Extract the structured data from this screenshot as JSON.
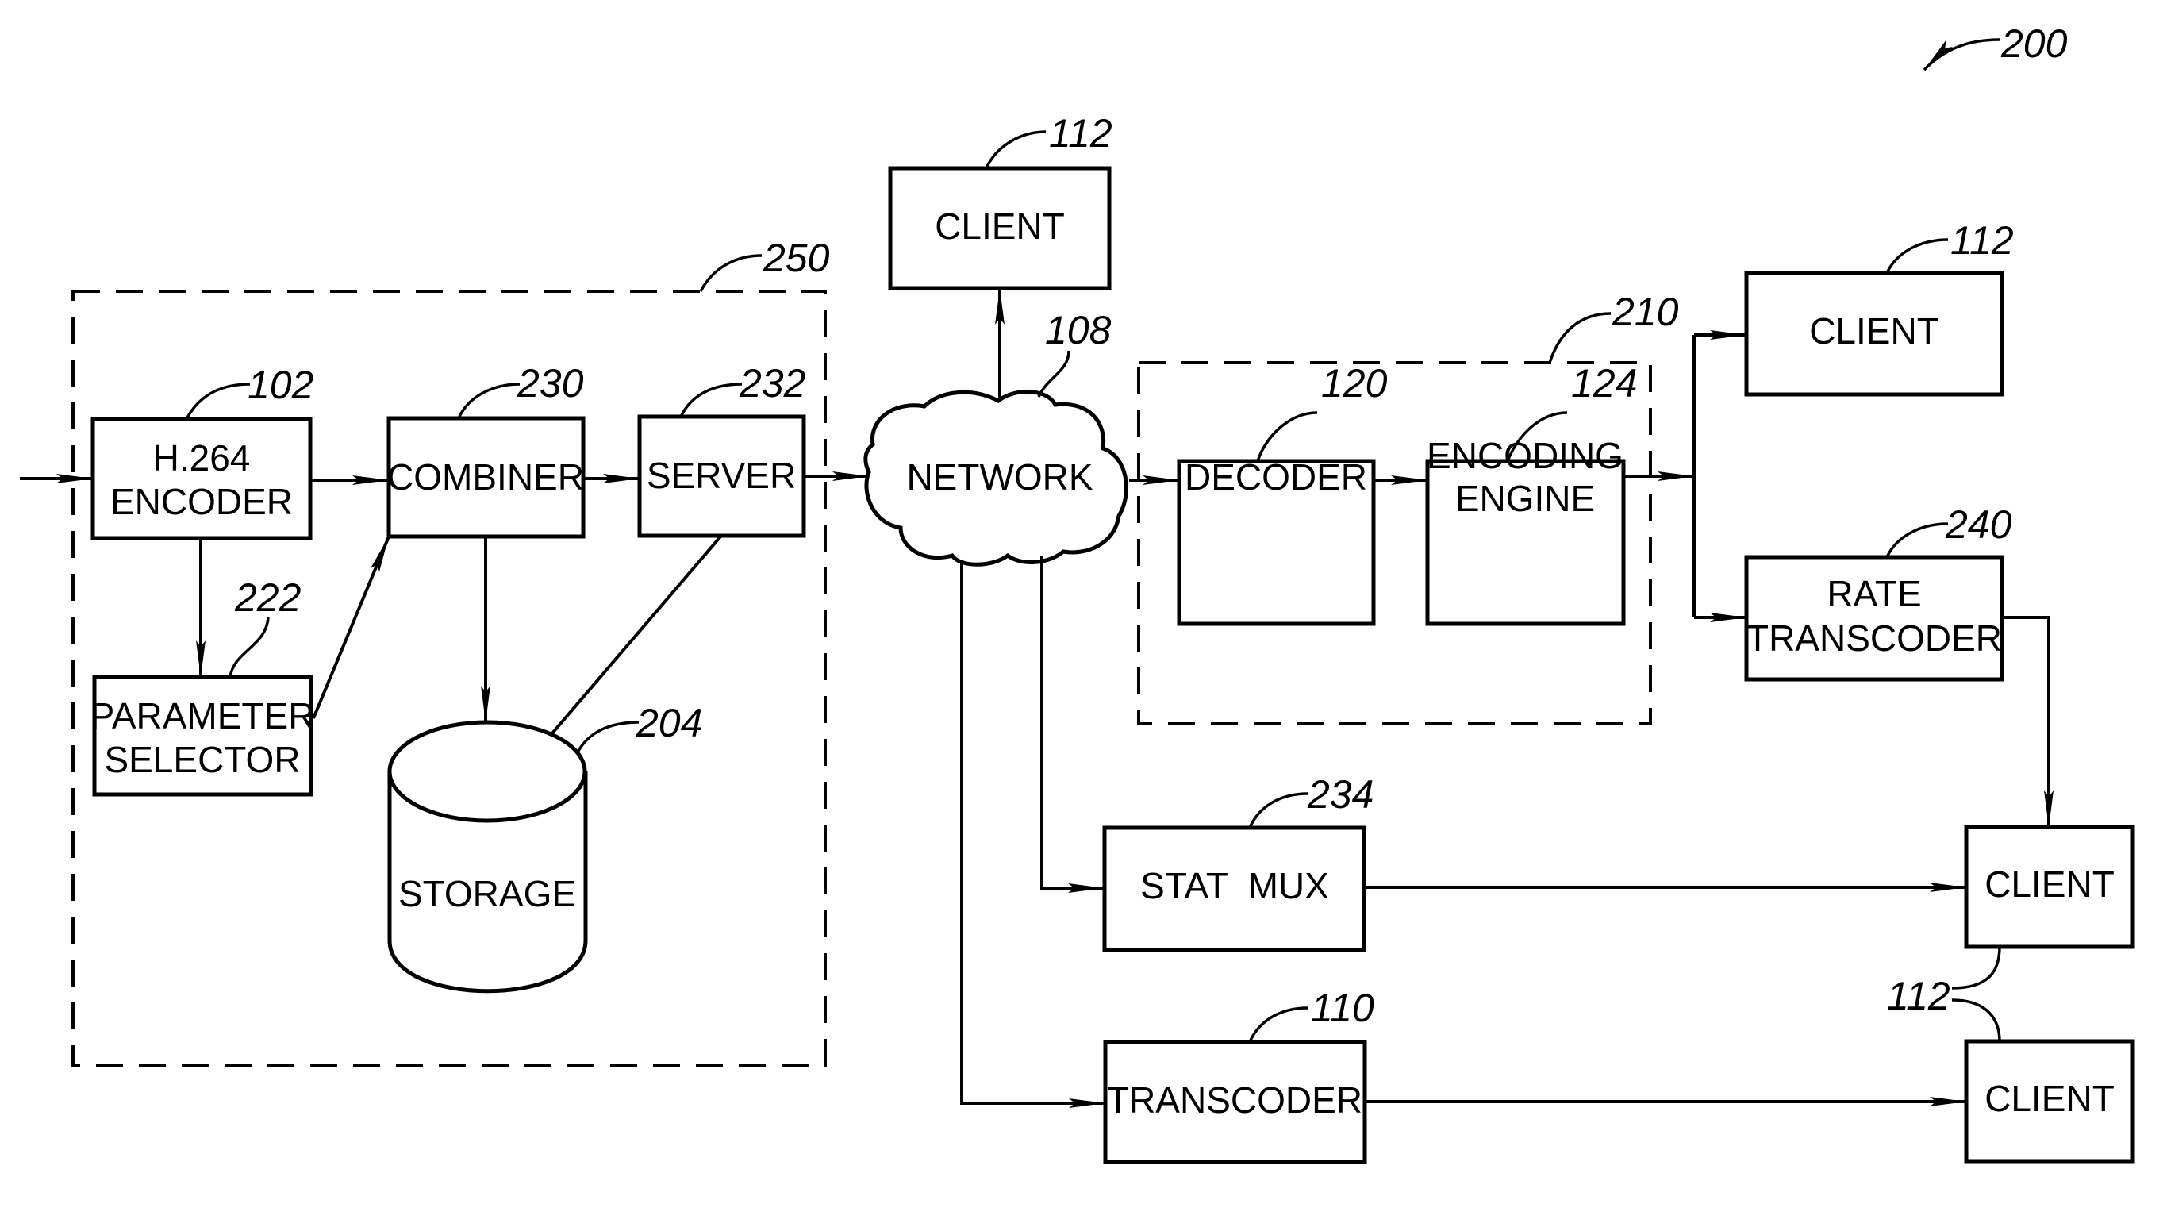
{
  "figure": {
    "reference": "200",
    "background": "#ffffff",
    "ink": "#000000"
  },
  "groups": [
    {
      "id": "source_system",
      "reference": "250"
    },
    {
      "id": "transcoding_unit",
      "reference": "210"
    }
  ],
  "blocks": {
    "h264_encoder": {
      "lines": [
        "H.264",
        "ENCODER"
      ],
      "reference": "102"
    },
    "parameter_selector": {
      "lines": [
        "PARAMETER",
        "SELECTOR"
      ],
      "reference": "222"
    },
    "combiner": {
      "lines": [
        "COMBINER"
      ],
      "reference": "230"
    },
    "server": {
      "lines": [
        "SERVER"
      ],
      "reference": "232"
    },
    "storage": {
      "lines": [
        "STORAGE"
      ],
      "reference": "204"
    },
    "network": {
      "lines": [
        "NETWORK"
      ],
      "reference": "108"
    },
    "client_top": {
      "lines": [
        "CLIENT"
      ],
      "reference": "112"
    },
    "decoder": {
      "lines": [
        "DECODER"
      ],
      "reference": "120"
    },
    "encoding_engine": {
      "lines": [
        "ENCODING",
        "ENGINE"
      ],
      "reference": "124"
    },
    "client_right": {
      "lines": [
        "CLIENT"
      ],
      "reference": "112"
    },
    "rate_transcoder": {
      "lines": [
        "RATE",
        "TRANSCODER"
      ],
      "reference": "240"
    },
    "stat_mux": {
      "lines": [
        "STAT  MUX"
      ],
      "reference": "234"
    },
    "transcoder": {
      "lines": [
        "TRANSCODER"
      ],
      "reference": "110"
    },
    "client_mid": {
      "lines": [
        "CLIENT"
      ]
    },
    "client_bottom": {
      "lines": [
        "CLIENT"
      ]
    },
    "shared_client_ref": "112"
  },
  "connections": [
    {
      "from": "input",
      "to": "h264_encoder"
    },
    {
      "from": "h264_encoder",
      "to": "combiner"
    },
    {
      "from": "h264_encoder",
      "to": "parameter_selector"
    },
    {
      "from": "parameter_selector",
      "to": "combiner"
    },
    {
      "from": "combiner",
      "to": "server"
    },
    {
      "from": "combiner",
      "to": "storage"
    },
    {
      "from": "server",
      "to": "storage",
      "arrow": false
    },
    {
      "from": "server",
      "to": "network"
    },
    {
      "from": "network",
      "to": "client_top"
    },
    {
      "from": "network",
      "to": "decoder"
    },
    {
      "from": "decoder",
      "to": "encoding_engine"
    },
    {
      "from": "encoding_engine",
      "to": "client_right"
    },
    {
      "from": "encoding_engine",
      "to": "rate_transcoder"
    },
    {
      "from": "rate_transcoder",
      "to": "client_mid"
    },
    {
      "from": "network",
      "to": "stat_mux"
    },
    {
      "from": "stat_mux",
      "to": "client_mid"
    },
    {
      "from": "network",
      "to": "transcoder"
    },
    {
      "from": "transcoder",
      "to": "client_bottom"
    }
  ]
}
